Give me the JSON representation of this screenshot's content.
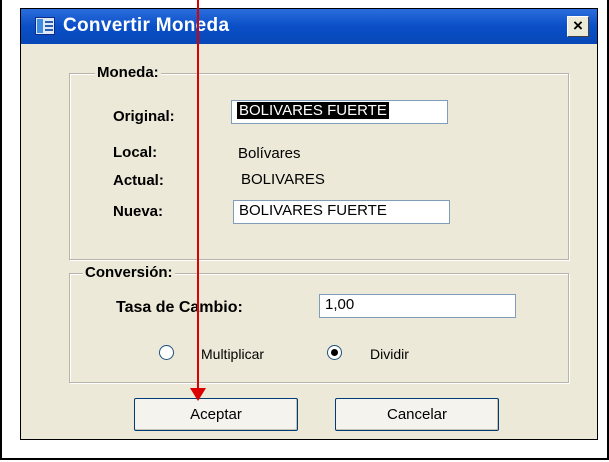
{
  "window": {
    "title": "Convertir Moneda",
    "close_symbol": "×"
  },
  "moneda": {
    "legend": "Moneda:",
    "original_label": "Original:",
    "original_value": "BOLIVARES FUERTE",
    "local_label": "Local:",
    "local_value": "Bolívares",
    "actual_label": "Actual:",
    "actual_value": "BOLIVARES",
    "nueva_label": "Nueva:",
    "nueva_value": "BOLIVARES FUERTE"
  },
  "conversion": {
    "legend": "Conversión:",
    "tasa_label": "Tasa de Cambio:",
    "tasa_value": "1,00",
    "option_multiplicar": "Multiplicar",
    "option_dividir": "Dividir",
    "selected_option": "Dividir"
  },
  "buttons": {
    "accept": "Aceptar",
    "cancel": "Cancelar"
  },
  "colors": {
    "annotation_arrow": "#dd0000",
    "titlebar": "#0a4fc7"
  },
  "icons": {
    "title": "form-window-icon",
    "close": "close-icon"
  }
}
